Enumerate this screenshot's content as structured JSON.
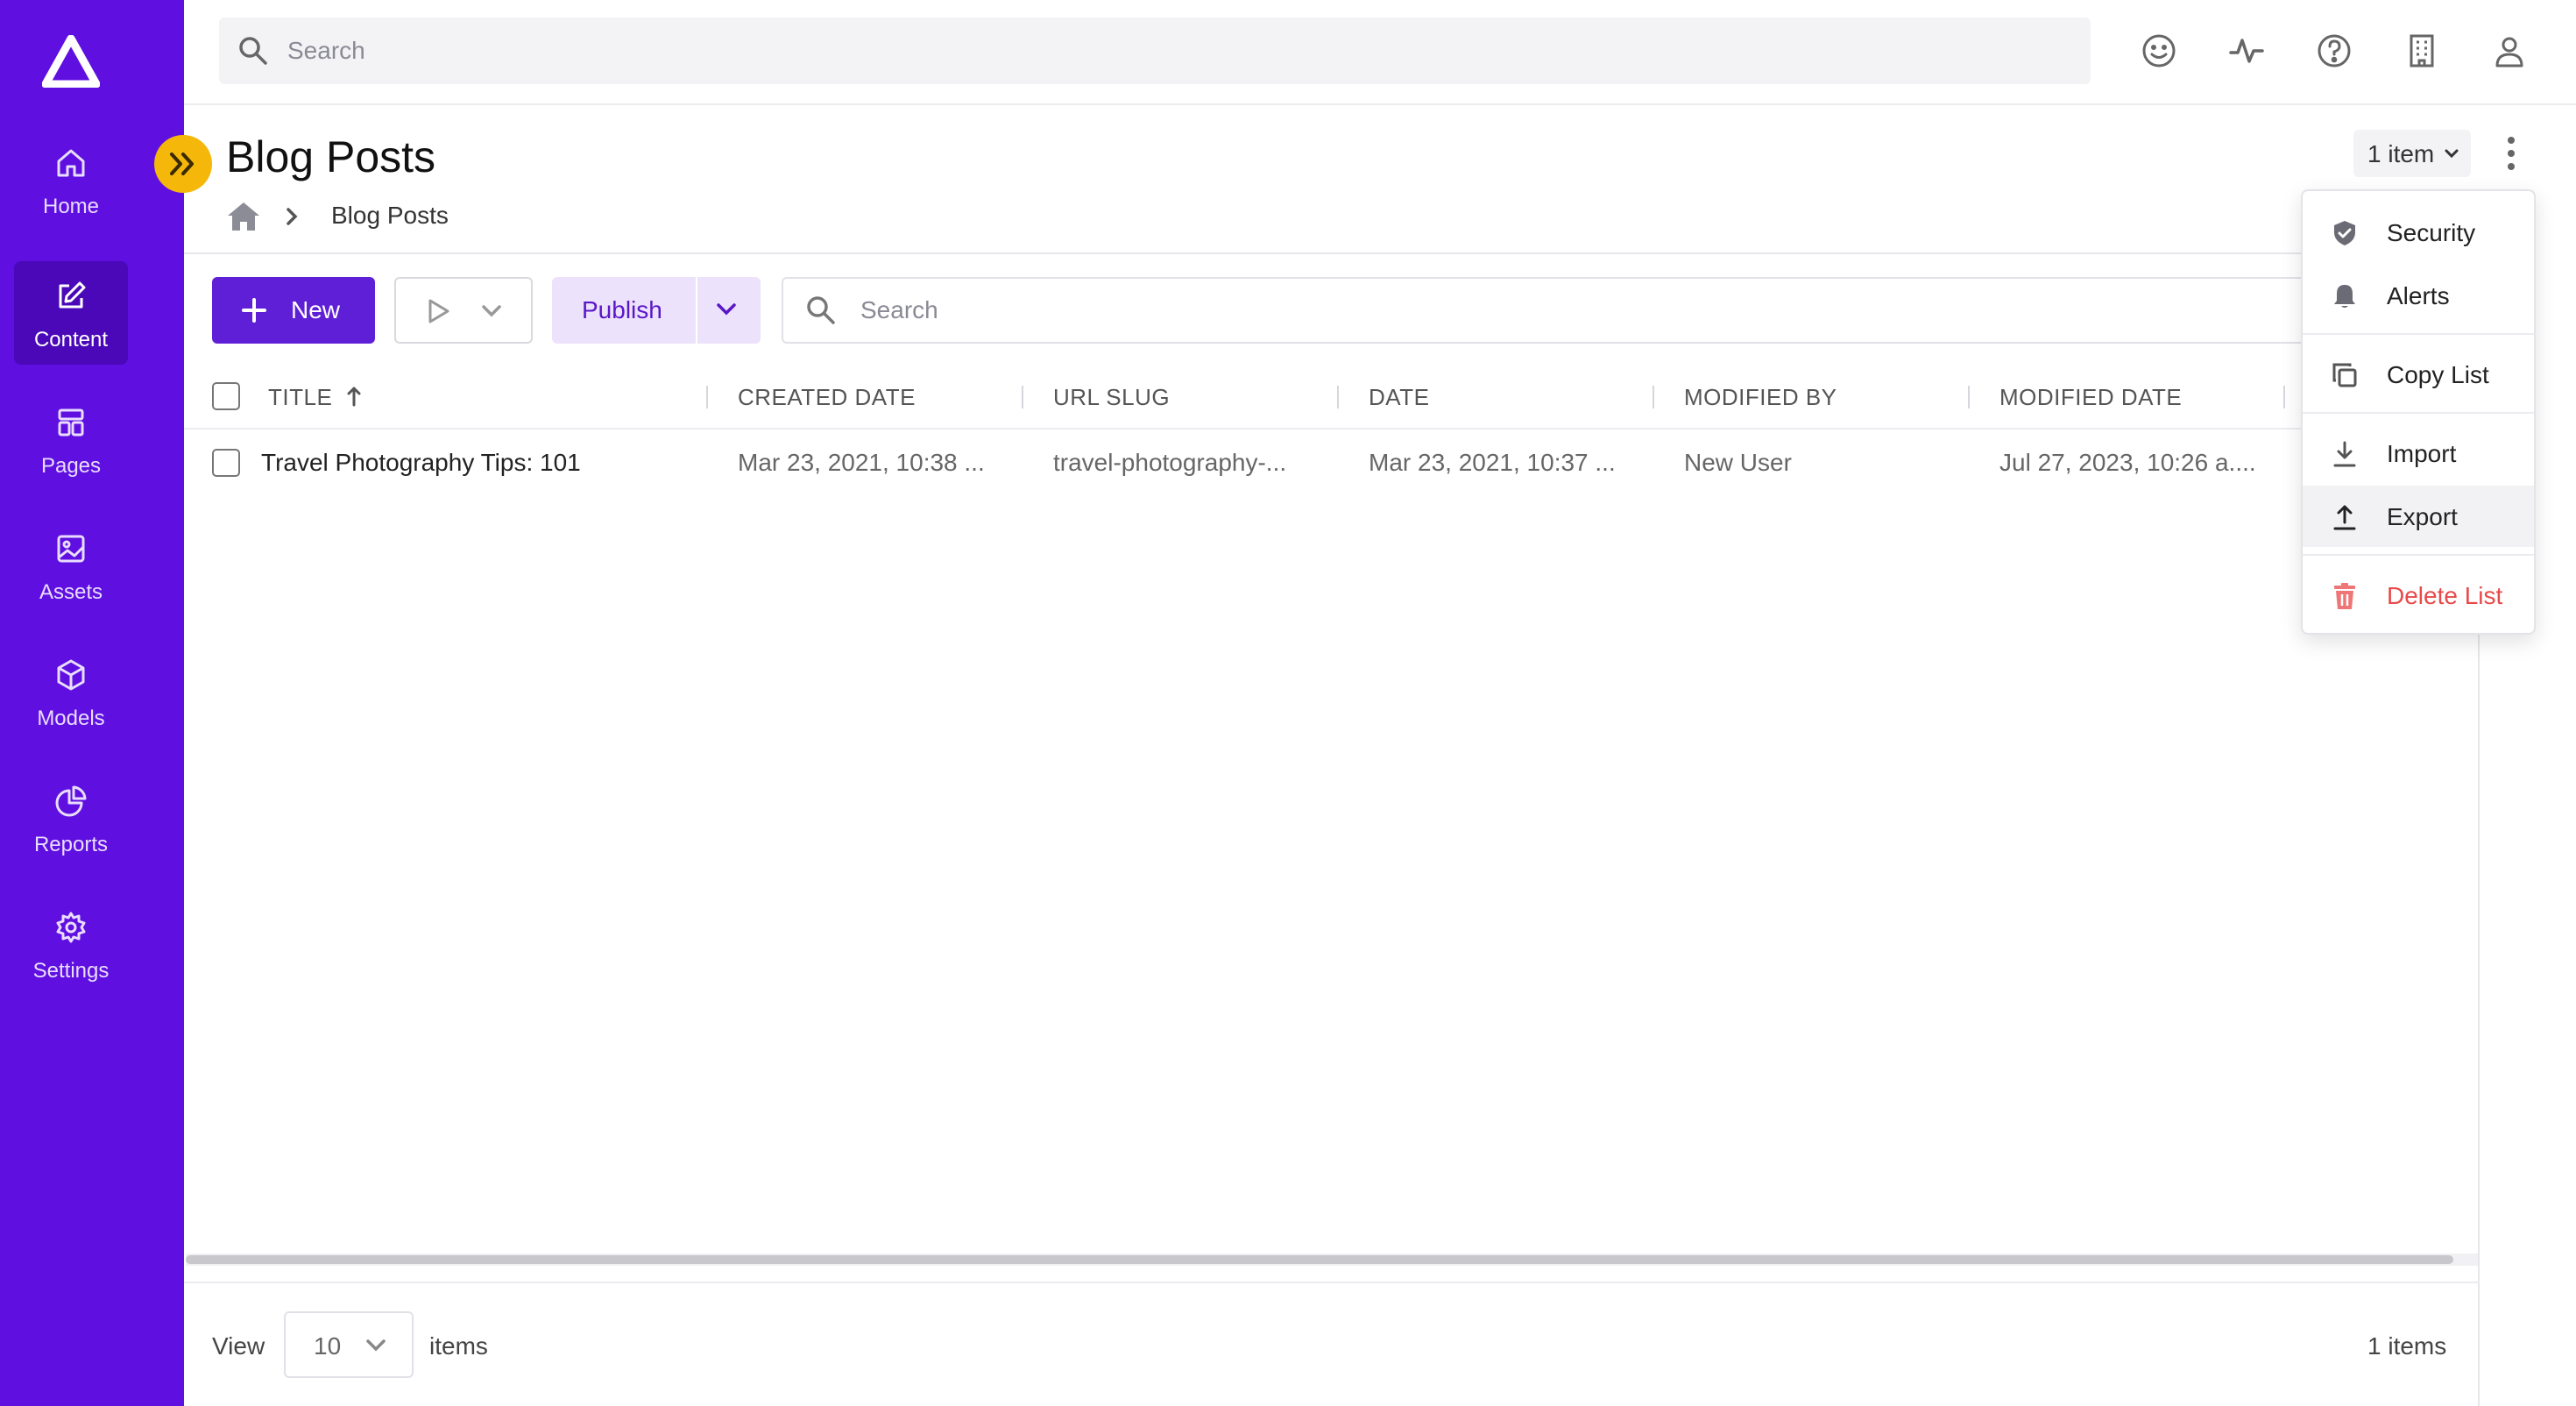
{
  "topbar": {
    "search_placeholder": "Search",
    "icons": [
      "smiley-icon",
      "activity-icon",
      "help-icon",
      "building-icon",
      "user-icon"
    ]
  },
  "sidebar": {
    "items": [
      {
        "label": "Home",
        "icon": "home-icon",
        "active": false
      },
      {
        "label": "Content",
        "icon": "edit-icon",
        "active": true
      },
      {
        "label": "Pages",
        "icon": "pages-icon",
        "active": false
      },
      {
        "label": "Assets",
        "icon": "image-icon",
        "active": false
      },
      {
        "label": "Models",
        "icon": "cube-icon",
        "active": false
      },
      {
        "label": "Reports",
        "icon": "pie-chart-icon",
        "active": false
      },
      {
        "label": "Settings",
        "icon": "gear-icon",
        "active": false
      }
    ]
  },
  "header": {
    "title": "Blog Posts",
    "breadcrumb_current": "Blog Posts",
    "item_count_label": "1 item"
  },
  "toolbar": {
    "new_label": "New",
    "publish_label": "Publish",
    "search_placeholder": "Search"
  },
  "table": {
    "columns": [
      "TITLE",
      "CREATED DATE",
      "URL SLUG",
      "DATE",
      "MODIFIED BY",
      "MODIFIED DATE"
    ],
    "rows": [
      {
        "title": "Travel Photography Tips: 101",
        "created_date": "Mar 23, 2021, 10:38 ...",
        "url_slug": "travel-photography-...",
        "date": "Mar 23, 2021, 10:37 ...",
        "modified_by": "New User",
        "modified_date": "Jul 27, 2023, 10:26 a...."
      }
    ]
  },
  "footer": {
    "view_label": "View",
    "page_size": "10",
    "items_label": "items",
    "total_label": "1 items"
  },
  "menu": {
    "items": [
      {
        "label": "Security",
        "icon": "shield-icon"
      },
      {
        "label": "Alerts",
        "icon": "bell-icon"
      },
      {
        "label": "Copy List",
        "icon": "copy-icon"
      },
      {
        "label": "Import",
        "icon": "download-icon"
      },
      {
        "label": "Export",
        "icon": "upload-icon"
      },
      {
        "label": "Delete List",
        "icon": "trash-icon"
      }
    ]
  },
  "colors": {
    "sidebar": "#5f0fe0",
    "primary": "#5f1fd6",
    "publish_bg": "#ece2fc",
    "collapse_btn": "#f5b70a",
    "danger": "#e84a4a"
  }
}
